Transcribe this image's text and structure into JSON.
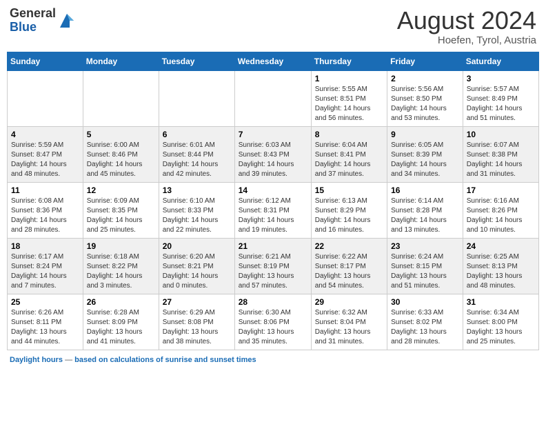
{
  "header": {
    "logo_general": "General",
    "logo_blue": "Blue",
    "month_year": "August 2024",
    "location": "Hoefen, Tyrol, Austria"
  },
  "footer": {
    "label": "Daylight hours",
    "description": "based on calculations of sunrise and sunset times"
  },
  "weekdays": [
    "Sunday",
    "Monday",
    "Tuesday",
    "Wednesday",
    "Thursday",
    "Friday",
    "Saturday"
  ],
  "weeks": [
    [
      {
        "day": "",
        "info": ""
      },
      {
        "day": "",
        "info": ""
      },
      {
        "day": "",
        "info": ""
      },
      {
        "day": "",
        "info": ""
      },
      {
        "day": "1",
        "info": "Sunrise: 5:55 AM\nSunset: 8:51 PM\nDaylight: 14 hours and 56 minutes."
      },
      {
        "day": "2",
        "info": "Sunrise: 5:56 AM\nSunset: 8:50 PM\nDaylight: 14 hours and 53 minutes."
      },
      {
        "day": "3",
        "info": "Sunrise: 5:57 AM\nSunset: 8:49 PM\nDaylight: 14 hours and 51 minutes."
      }
    ],
    [
      {
        "day": "4",
        "info": "Sunrise: 5:59 AM\nSunset: 8:47 PM\nDaylight: 14 hours and 48 minutes."
      },
      {
        "day": "5",
        "info": "Sunrise: 6:00 AM\nSunset: 8:46 PM\nDaylight: 14 hours and 45 minutes."
      },
      {
        "day": "6",
        "info": "Sunrise: 6:01 AM\nSunset: 8:44 PM\nDaylight: 14 hours and 42 minutes."
      },
      {
        "day": "7",
        "info": "Sunrise: 6:03 AM\nSunset: 8:43 PM\nDaylight: 14 hours and 39 minutes."
      },
      {
        "day": "8",
        "info": "Sunrise: 6:04 AM\nSunset: 8:41 PM\nDaylight: 14 hours and 37 minutes."
      },
      {
        "day": "9",
        "info": "Sunrise: 6:05 AM\nSunset: 8:39 PM\nDaylight: 14 hours and 34 minutes."
      },
      {
        "day": "10",
        "info": "Sunrise: 6:07 AM\nSunset: 8:38 PM\nDaylight: 14 hours and 31 minutes."
      }
    ],
    [
      {
        "day": "11",
        "info": "Sunrise: 6:08 AM\nSunset: 8:36 PM\nDaylight: 14 hours and 28 minutes."
      },
      {
        "day": "12",
        "info": "Sunrise: 6:09 AM\nSunset: 8:35 PM\nDaylight: 14 hours and 25 minutes."
      },
      {
        "day": "13",
        "info": "Sunrise: 6:10 AM\nSunset: 8:33 PM\nDaylight: 14 hours and 22 minutes."
      },
      {
        "day": "14",
        "info": "Sunrise: 6:12 AM\nSunset: 8:31 PM\nDaylight: 14 hours and 19 minutes."
      },
      {
        "day": "15",
        "info": "Sunrise: 6:13 AM\nSunset: 8:29 PM\nDaylight: 14 hours and 16 minutes."
      },
      {
        "day": "16",
        "info": "Sunrise: 6:14 AM\nSunset: 8:28 PM\nDaylight: 14 hours and 13 minutes."
      },
      {
        "day": "17",
        "info": "Sunrise: 6:16 AM\nSunset: 8:26 PM\nDaylight: 14 hours and 10 minutes."
      }
    ],
    [
      {
        "day": "18",
        "info": "Sunrise: 6:17 AM\nSunset: 8:24 PM\nDaylight: 14 hours and 7 minutes."
      },
      {
        "day": "19",
        "info": "Sunrise: 6:18 AM\nSunset: 8:22 PM\nDaylight: 14 hours and 3 minutes."
      },
      {
        "day": "20",
        "info": "Sunrise: 6:20 AM\nSunset: 8:21 PM\nDaylight: 14 hours and 0 minutes."
      },
      {
        "day": "21",
        "info": "Sunrise: 6:21 AM\nSunset: 8:19 PM\nDaylight: 13 hours and 57 minutes."
      },
      {
        "day": "22",
        "info": "Sunrise: 6:22 AM\nSunset: 8:17 PM\nDaylight: 13 hours and 54 minutes."
      },
      {
        "day": "23",
        "info": "Sunrise: 6:24 AM\nSunset: 8:15 PM\nDaylight: 13 hours and 51 minutes."
      },
      {
        "day": "24",
        "info": "Sunrise: 6:25 AM\nSunset: 8:13 PM\nDaylight: 13 hours and 48 minutes."
      }
    ],
    [
      {
        "day": "25",
        "info": "Sunrise: 6:26 AM\nSunset: 8:11 PM\nDaylight: 13 hours and 44 minutes."
      },
      {
        "day": "26",
        "info": "Sunrise: 6:28 AM\nSunset: 8:09 PM\nDaylight: 13 hours and 41 minutes."
      },
      {
        "day": "27",
        "info": "Sunrise: 6:29 AM\nSunset: 8:08 PM\nDaylight: 13 hours and 38 minutes."
      },
      {
        "day": "28",
        "info": "Sunrise: 6:30 AM\nSunset: 8:06 PM\nDaylight: 13 hours and 35 minutes."
      },
      {
        "day": "29",
        "info": "Sunrise: 6:32 AM\nSunset: 8:04 PM\nDaylight: 13 hours and 31 minutes."
      },
      {
        "day": "30",
        "info": "Sunrise: 6:33 AM\nSunset: 8:02 PM\nDaylight: 13 hours and 28 minutes."
      },
      {
        "day": "31",
        "info": "Sunrise: 6:34 AM\nSunset: 8:00 PM\nDaylight: 13 hours and 25 minutes."
      }
    ]
  ]
}
